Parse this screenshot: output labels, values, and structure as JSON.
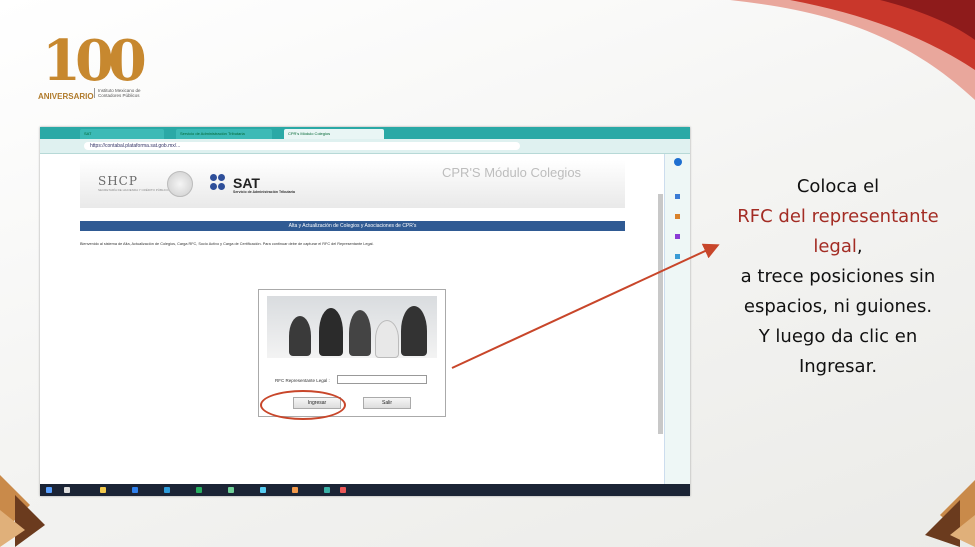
{
  "logo": {
    "number": "100",
    "anniversary": "ANIVERSARIO",
    "org": "Instituto Mexicano de Contadores Públicos"
  },
  "browser": {
    "tabs": [
      "SAT",
      "Servicio de Administración Tributaria",
      "CPR's Módulo Colegios"
    ],
    "url": "https://contabal.plataforma.sat.gob.mx/..."
  },
  "page": {
    "shcp": "SHCP",
    "shcp_sub": "SECRETARÍA DE HACIENDA Y CRÉDITO PÚBLICO",
    "sat": "SAT",
    "sat_sub": "Servicio de Administración Tributaria",
    "module_title": "CPR'S Módulo Colegios",
    "bar_title": "Alta y Actualización de Colegios y Asociaciones de CPR's",
    "intro": "Bienvenido al sistema de Alta, Actualización de Colegios, Carga RFC, Socio Activo y Carga de Certificación. Para continuar debe de capturar el RFC del Representante Legal.",
    "rfc_label": "RFC Representante Legal :",
    "rfc_value": "",
    "ingresar": "Ingresar",
    "salir": "Salir"
  },
  "instructions": {
    "line1": "Coloca el",
    "line2": "RFC del representante",
    "line3a": "legal",
    "line3b": ",",
    "line4": "a trece posiciones sin",
    "line5": "espacios, ni guiones.",
    "line6": "Y luego da clic en",
    "line7": "Ingresar."
  },
  "colors": {
    "accent_red": "#a32c24",
    "annotation": "#c8462a",
    "gold": "#c7882f",
    "sat_blue": "#2f5a93",
    "browser_teal": "#2aa9a6"
  }
}
